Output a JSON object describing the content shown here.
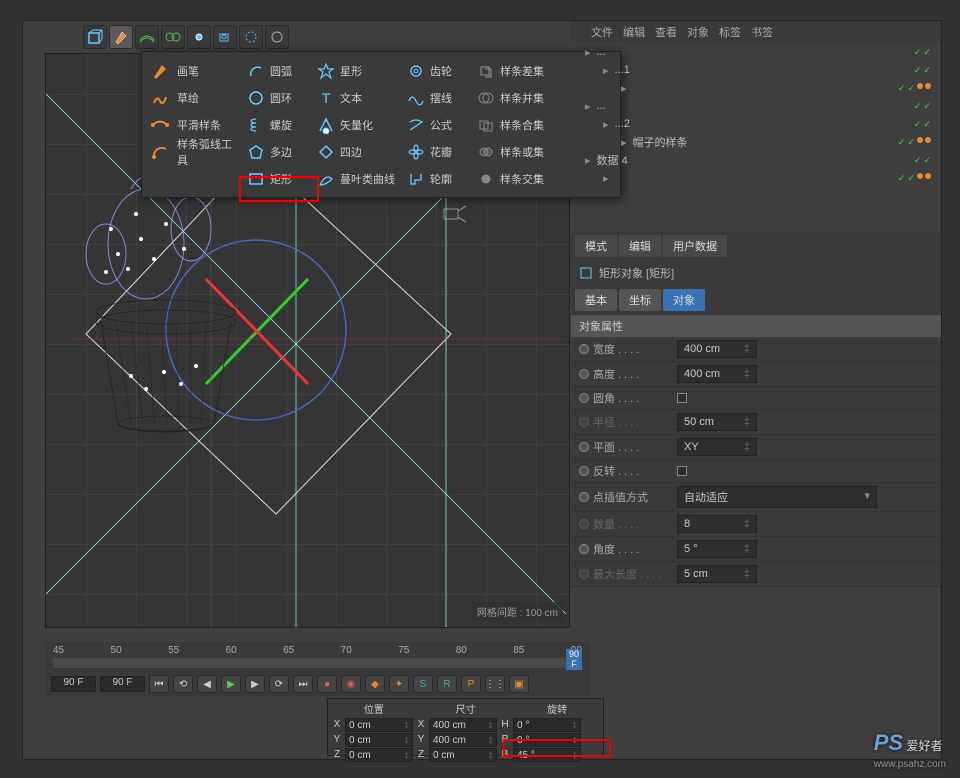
{
  "toolbar": {
    "cube": "cube-icon",
    "pen": "pen-icon",
    "car": "car-icon",
    "ext": "ext-icon",
    "a": "a-icon",
    "b": "b-icon",
    "c": "c-icon"
  },
  "popup": {
    "col1": [
      {
        "icon": "pen",
        "label": "画笔"
      },
      {
        "icon": "sketch",
        "label": "草绘"
      },
      {
        "icon": "smooth",
        "label": "平滑样条"
      },
      {
        "icon": "arc-tool",
        "label": "样条弧线工具"
      }
    ],
    "col2": [
      {
        "icon": "arc",
        "label": "圆弧"
      },
      {
        "icon": "circle",
        "label": "圆环"
      },
      {
        "icon": "helix",
        "label": "螺旋"
      },
      {
        "icon": "nside",
        "label": "多边"
      },
      {
        "icon": "rect",
        "label": "矩形"
      }
    ],
    "col3": [
      {
        "icon": "star",
        "label": "星形"
      },
      {
        "icon": "text",
        "label": "文本"
      },
      {
        "icon": "vector",
        "label": "矢量化"
      },
      {
        "icon": "4side",
        "label": "四边"
      },
      {
        "icon": "leaf",
        "label": "蔓叶类曲线"
      }
    ],
    "col4": [
      {
        "icon": "gear",
        "label": "齿轮"
      },
      {
        "icon": "cycloid",
        "label": "摆线"
      },
      {
        "icon": "formula",
        "label": "公式"
      },
      {
        "icon": "flower",
        "label": "花瓣"
      },
      {
        "icon": "profile",
        "label": "轮廓"
      }
    ],
    "col5": [
      {
        "icon": "mask",
        "label": "样条差集"
      },
      {
        "icon": "union",
        "label": "样条并集"
      },
      {
        "icon": "and",
        "label": "样条合集"
      },
      {
        "icon": "or",
        "label": "样条或集"
      },
      {
        "icon": "inter",
        "label": "样条交集"
      }
    ]
  },
  "side_menu": [
    "文件",
    "编辑",
    "查看",
    "对象",
    "标签",
    "书签"
  ],
  "obj_tree": [
    {
      "name": "...",
      "pad": 14,
      "dots": 2
    },
    {
      "name": "...1",
      "pad": 32,
      "dots": 2
    },
    {
      "name": "",
      "pad": 50,
      "dots": 2,
      "ext": true
    },
    {
      "name": "...",
      "pad": 14,
      "dots": 2
    },
    {
      "name": "...2",
      "pad": 32,
      "dots": 2
    },
    {
      "name": "帽子的样条",
      "pad": 50,
      "dots": 2,
      "ext": true
    },
    {
      "name": "数据 4",
      "pad": 14,
      "dots": 2
    },
    {
      "name": "",
      "pad": 32,
      "dots": 2,
      "ext": true
    }
  ],
  "tabs_top": [
    "模式",
    "编辑",
    "用户数据"
  ],
  "obj_title": "矩形对象 [矩形]",
  "tabs_attr": [
    {
      "label": "基本",
      "active": false
    },
    {
      "label": "坐标",
      "active": false
    },
    {
      "label": "对象",
      "active": true
    }
  ],
  "attrs_header": "对象属性",
  "attrs": [
    {
      "name": "宽度",
      "val": "400 cm",
      "type": "r"
    },
    {
      "name": "高度",
      "val": "400 cm",
      "type": "r"
    },
    {
      "name": "圆角",
      "val": "",
      "type": "c"
    },
    {
      "name": "半径",
      "val": "50 cm",
      "type": "r",
      "dim": true
    },
    {
      "name": "平面",
      "val": "XY",
      "type": "s"
    },
    {
      "name": "反转",
      "val": "",
      "type": "c"
    }
  ],
  "attrs2_header": "点插值方式",
  "attrs2_val": "自动适应",
  "attrs2": [
    {
      "name": "数量",
      "val": "8",
      "type": "r",
      "dim": true
    },
    {
      "name": "角度",
      "val": "5 °",
      "type": "r"
    },
    {
      "name": "最大长度",
      "val": "5 cm",
      "type": "r",
      "dim": true
    }
  ],
  "timeline": {
    "labels": [
      "45",
      "50",
      "55",
      "60",
      "65",
      "70",
      "75",
      "80",
      "85",
      "90"
    ],
    "end": "90 F",
    "r": "▸",
    "ra": "▸"
  },
  "frame_in": "90 F",
  "frame_out": "90 F",
  "grid_info": "网格间距 : 100 cm",
  "coord": {
    "hdr": [
      "位置",
      "尺寸",
      "旋转"
    ],
    "rows": [
      {
        "a": "X",
        "v1": "0 cm",
        "b": "X",
        "v2": "400 cm",
        "c": "H",
        "v3": "0 °"
      },
      {
        "a": "Y",
        "v1": "0 cm",
        "b": "Y",
        "v2": "400 cm",
        "c": "P",
        "v3": "0 °"
      },
      {
        "a": "Z",
        "v1": "0 cm",
        "b": "Z",
        "v2": "0 cm",
        "c": "B",
        "v3": "45 °"
      }
    ]
  },
  "watermark": {
    "ps": "PS",
    "zh": "爱好者",
    "url": "www.psahz.com"
  },
  "spin": "‡"
}
